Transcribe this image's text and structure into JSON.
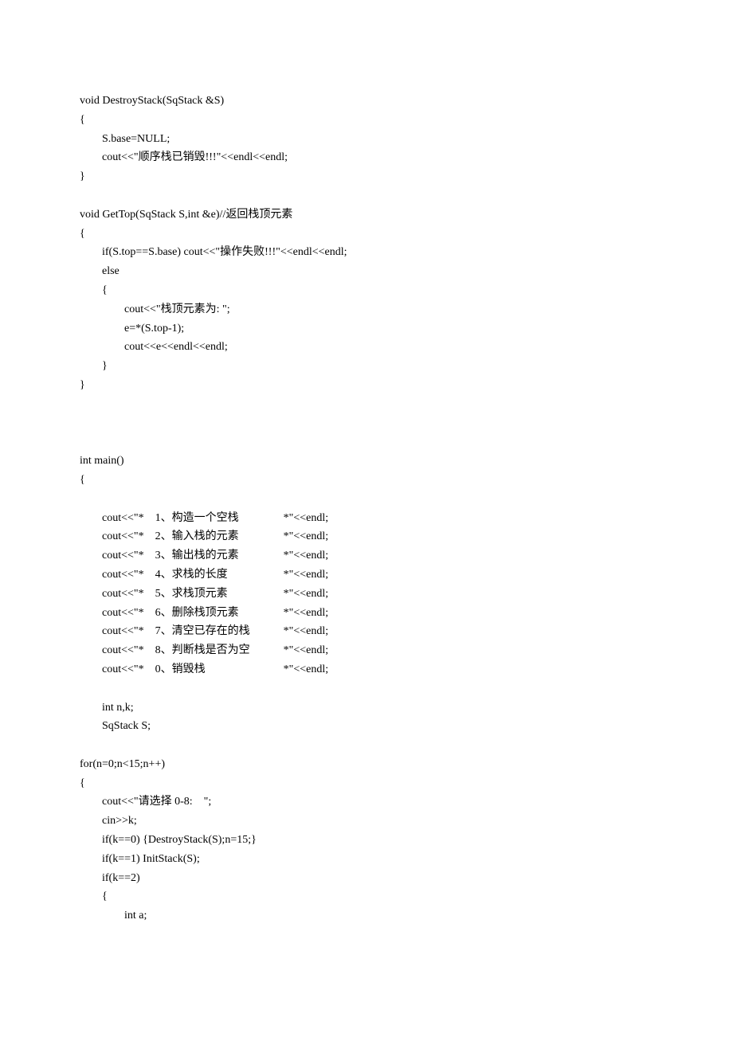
{
  "lines": [
    "void DestroyStack(SqStack &S)",
    "{",
    "        S.base=NULL;",
    "        cout<<\"顺序栈已销毁!!!\"<<endl<<endl;",
    "}",
    "",
    "void GetTop(SqStack S,int &e)//返回栈顶元素",
    "{",
    "        if(S.top==S.base) cout<<\"操作失败!!!\"<<endl<<endl;",
    "        else",
    "        {",
    "                cout<<\"栈顶元素为: \";",
    "                e=*(S.top-1);",
    "                cout<<e<<endl<<endl;",
    "        }",
    "}",
    "",
    "",
    "",
    "int main()",
    "{",
    "",
    "        cout<<\"*    1、构造一个空栈                *\"<<endl;",
    "        cout<<\"*    2、输入栈的元素                *\"<<endl;",
    "        cout<<\"*    3、输出栈的元素                *\"<<endl;",
    "        cout<<\"*    4、求栈的长度                    *\"<<endl;",
    "        cout<<\"*    5、求栈顶元素                    *\"<<endl;",
    "        cout<<\"*    6、删除栈顶元素                *\"<<endl;",
    "        cout<<\"*    7、清空已存在的栈            *\"<<endl;",
    "        cout<<\"*    8、判断栈是否为空            *\"<<endl;",
    "        cout<<\"*    0、销毁栈                            *\"<<endl;",
    "",
    "        int n,k;",
    "        SqStack S;",
    "",
    "for(n=0;n<15;n++)",
    "{",
    "        cout<<\"请选择 0-8:    \";",
    "        cin>>k;",
    "        if(k==0) {DestroyStack(S);n=15;}",
    "        if(k==1) InitStack(S);",
    "        if(k==2)",
    "        {",
    "                int a;"
  ]
}
